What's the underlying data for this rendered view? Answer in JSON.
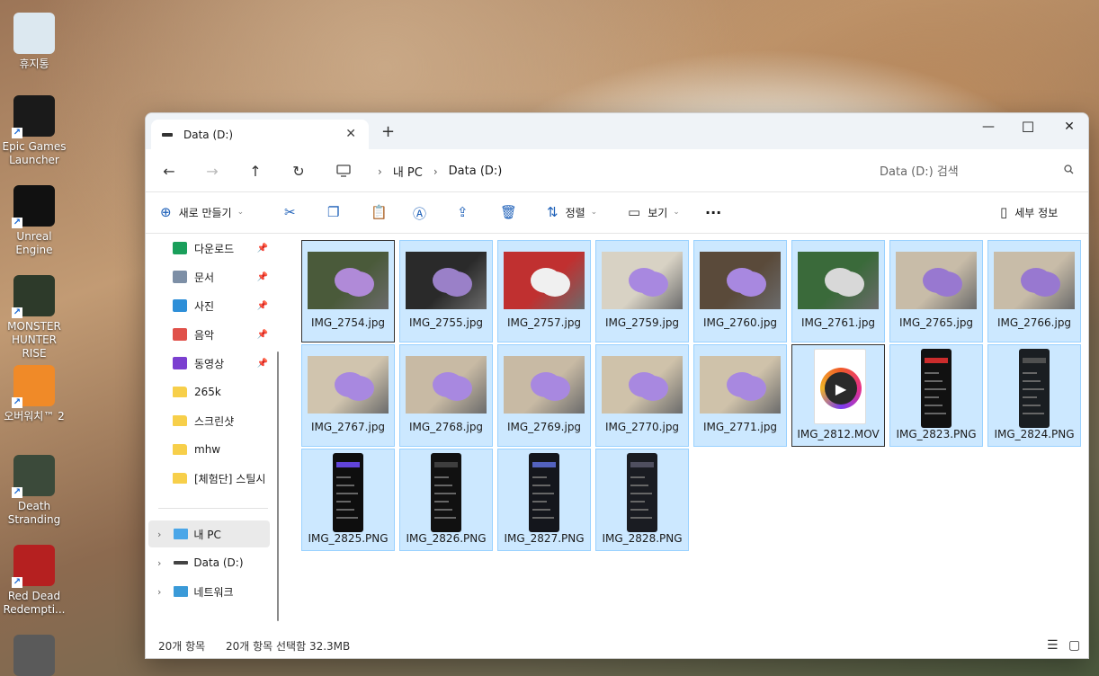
{
  "desktop": {
    "icons": [
      {
        "label": "휴지통",
        "icon": "recycle-bin-icon",
        "color": "#dce8f0"
      },
      {
        "label": "Epic Games\nLauncher",
        "icon": "epic-games-icon",
        "color": "#1a1a1a"
      },
      {
        "label": "Unreal\nEngine",
        "icon": "unreal-engine-icon",
        "color": "#111111"
      },
      {
        "label": "MONSTER\nHUNTER RISE",
        "icon": "monster-hunter-icon",
        "color": "#2d3a2a"
      },
      {
        "label": "오버워치™ 2",
        "icon": "overwatch-icon",
        "color": "#f08a28"
      },
      {
        "label": "Death\nStranding",
        "icon": "death-stranding-icon",
        "color": "#3b4a3a"
      },
      {
        "label": "Red Dead\nRedempti...",
        "icon": "red-dead-icon",
        "color": "#b52020"
      },
      {
        "label": "",
        "icon": "pubg-icon",
        "color": "#5a5a5a"
      }
    ]
  },
  "window": {
    "tab_title": "Data (D:)",
    "new_tab": "+",
    "controls": {
      "minimize": "—",
      "maximize": "☐",
      "close": "✕"
    }
  },
  "nav": {
    "back": "←",
    "forward": "→",
    "up": "↑",
    "refresh": "↻",
    "breadcrumb": [
      "내 PC",
      "Data (D:)"
    ],
    "search_placeholder": "Data (D:) 검색"
  },
  "toolbar": {
    "new_label": "새로 만들기",
    "sort_label": "정렬",
    "view_label": "보기",
    "more": "···",
    "details_label": "세부 정보"
  },
  "sidebar": {
    "quick_access": [
      {
        "label": "다운로드",
        "icon": "download-icon",
        "color": "#1a9f5b",
        "pinned": true
      },
      {
        "label": "문서",
        "icon": "document-icon",
        "color": "#7d8fa6",
        "pinned": true
      },
      {
        "label": "사진",
        "icon": "pictures-icon",
        "color": "#2e8fd8",
        "pinned": true
      },
      {
        "label": "음악",
        "icon": "music-icon",
        "color": "#e0514a",
        "pinned": true
      },
      {
        "label": "동영상",
        "icon": "videos-icon",
        "color": "#7b3fd0",
        "pinned": true
      },
      {
        "label": "265k",
        "icon": "folder-icon",
        "color": "#f7cf4a",
        "pinned": false
      },
      {
        "label": "스크린샷",
        "icon": "folder-icon",
        "color": "#f7cf4a",
        "pinned": false
      },
      {
        "label": "mhw",
        "icon": "folder-icon",
        "color": "#f7cf4a",
        "pinned": false
      },
      {
        "label": "[체험단] 스틸시",
        "icon": "folder-icon",
        "color": "#f7cf4a",
        "pinned": false
      }
    ],
    "roots": [
      {
        "label": "내 PC",
        "icon": "this-pc-icon",
        "selected": true
      },
      {
        "label": "Data (D:)",
        "icon": "drive-icon",
        "selected": false
      },
      {
        "label": "네트워크",
        "icon": "network-icon",
        "selected": false
      }
    ]
  },
  "files": [
    {
      "name": "IMG_2754.jpg",
      "kind": "photo",
      "bg": "#4a5a3a",
      "accent": "#b08ad8"
    },
    {
      "name": "IMG_2755.jpg",
      "kind": "photo",
      "bg": "#2a2a2a",
      "accent": "#9a80c8"
    },
    {
      "name": "IMG_2757.jpg",
      "kind": "photo",
      "bg": "#c03030",
      "accent": "#f0f0f0"
    },
    {
      "name": "IMG_2759.jpg",
      "kind": "photo",
      "bg": "#d8d2c4",
      "accent": "#a888e0"
    },
    {
      "name": "IMG_2760.jpg",
      "kind": "photo",
      "bg": "#5a4a3a",
      "accent": "#a888e0"
    },
    {
      "name": "IMG_2761.jpg",
      "kind": "photo",
      "bg": "#3a6a3a",
      "accent": "#d8d8d8"
    },
    {
      "name": "IMG_2765.jpg",
      "kind": "photo",
      "bg": "#c8bca8",
      "accent": "#9878d0"
    },
    {
      "name": "IMG_2766.jpg",
      "kind": "photo",
      "bg": "#c8bca8",
      "accent": "#9878d0"
    },
    {
      "name": "IMG_2767.jpg",
      "kind": "photo",
      "bg": "#d0c4ae",
      "accent": "#a888e0"
    },
    {
      "name": "IMG_2768.jpg",
      "kind": "photo",
      "bg": "#c8baa4",
      "accent": "#a888e0"
    },
    {
      "name": "IMG_2769.jpg",
      "kind": "photo",
      "bg": "#c8baa4",
      "accent": "#a888e0"
    },
    {
      "name": "IMG_2770.jpg",
      "kind": "photo",
      "bg": "#cfc2aa",
      "accent": "#a888e0"
    },
    {
      "name": "IMG_2771.jpg",
      "kind": "photo",
      "bg": "#cfc2aa",
      "accent": "#a888e0"
    },
    {
      "name": "IMG_2812.MOV",
      "kind": "movie",
      "bg": "#ffffff",
      "accent": "#e8308a"
    },
    {
      "name": "IMG_2823.PNG",
      "kind": "screen",
      "bg": "#111111",
      "accent": "#e03030"
    },
    {
      "name": "IMG_2824.PNG",
      "kind": "screen",
      "bg": "#1a1e22",
      "accent": "#555555"
    },
    {
      "name": "IMG_2825.PNG",
      "kind": "screen",
      "bg": "#0e0e0e",
      "accent": "#6a4af0"
    },
    {
      "name": "IMG_2826.PNG",
      "kind": "screen",
      "bg": "#111111",
      "accent": "#444444"
    },
    {
      "name": "IMG_2827.PNG",
      "kind": "screen",
      "bg": "#14161c",
      "accent": "#5a6ad0"
    },
    {
      "name": "IMG_2828.PNG",
      "kind": "screen",
      "bg": "#1a1c22",
      "accent": "#556"
    }
  ],
  "status": {
    "count": "20개 항목",
    "selection": "20개 항목 선택함 32.3MB"
  }
}
